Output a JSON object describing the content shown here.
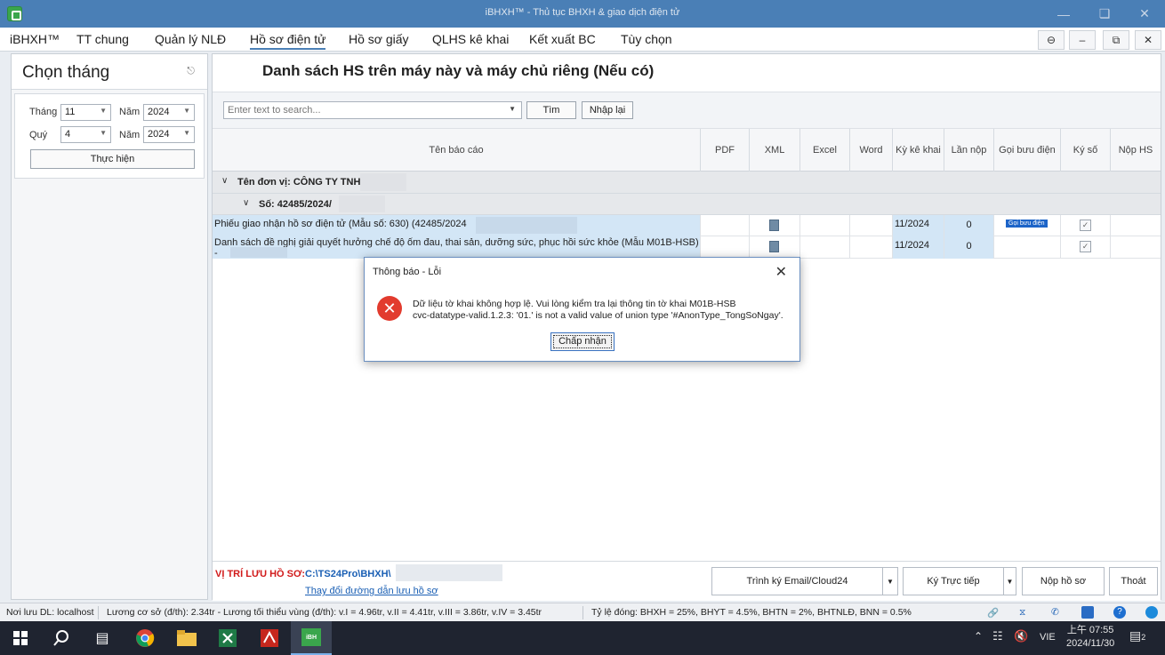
{
  "window": {
    "title": "iBHXH™ - Thủ tục BHXH & giao dịch điện tử"
  },
  "menu": {
    "items": [
      "iBHXH™",
      "TT chung",
      "Quản lý NLĐ",
      "Hồ sơ điện tử",
      "Hồ sơ giấy",
      "QLHS kê khai",
      "Kết xuất BC",
      "Tùy chọn"
    ],
    "active": "Hồ sơ điện tử"
  },
  "left": {
    "title": "Chọn tháng",
    "thang_label": "Tháng",
    "thang_value": "11",
    "nam_label": "Năm",
    "nam_value": "2024",
    "quy_label": "Quý",
    "quy_value": "4",
    "nam2_label": "Năm",
    "nam2_value": "2024",
    "run_button": "Thực hiện"
  },
  "main": {
    "heading": "Danh sách HS trên máy này và máy chủ riêng (Nếu có)",
    "search_placeholder": "Enter text to search...",
    "find_button": "Tìm",
    "reset_button": "Nhập lại",
    "columns": [
      "Tên báo cáo",
      "PDF",
      "XML",
      "Excel",
      "Word",
      "Kỳ kê khai",
      "Lần nộp",
      "Gọi bưu điện",
      "Ký số",
      "Nộp HS"
    ],
    "group1": "Tên đơn vị: CÔNG TY TNHH",
    "group2": "Số: 42485/2024/",
    "rows": [
      {
        "name": "Phiếu giao nhận hồ sơ điện tử (Mẫu số: 630) (42485/2024",
        "period": "11/2024",
        "submit": "0",
        "post": "Gọi bưu điện"
      },
      {
        "name": " Danh sách đề nghị giải quyết hưởng chế độ ốm đau, thai sản, dưỡng sức, phục hồi sức khỏe (Mẫu M01B-HSB)",
        "name_tail": "-",
        "period": "11/2024",
        "submit": "0",
        "post": ""
      }
    ],
    "location_label": "VỊ TRÍ LƯU HỒ SƠ:",
    "location_path": "C:\\TS24Pro\\BHXH\\",
    "change_link": "Thay đổi đường dẫn lưu hồ sơ",
    "btn_email": "Trình ký Email/Cloud24",
    "btn_direct": "Ký Trực tiếp",
    "btn_submit": "Nộp hồ sơ",
    "btn_exit": "Thoát"
  },
  "dialog": {
    "title": "Thông báo - Lỗi",
    "line1": "Dữ liệu tờ khai không hợp lệ. Vui lòng kiểm tra lại thông tin tờ khai M01B-HSB",
    "line2": "cvc-datatype-valid.1.2.3: '01.' is not a valid value of union type '#AnonType_TongSoNgay'.",
    "ok": "Chấp nhận"
  },
  "status": {
    "db": "Nơi lưu DL: localhost",
    "salary": "Lương cơ sở (đ/th): 2.34tr - Lương tối thiểu vùng (đ/th): v.I =  4.96tr, v.II = 4.41tr, v.III = 3.86tr, v.IV = 3.45tr",
    "rates": "Tỷ lệ đóng: BHXH = 25%, BHYT = 4.5%, BHTN = 2%, BHTNLĐ, BNN = 0.5%"
  },
  "taskbar": {
    "lang": "VIE",
    "time_line1": "上午 07:55",
    "time_line2": "2024/11/30",
    "notif_count": "2"
  }
}
